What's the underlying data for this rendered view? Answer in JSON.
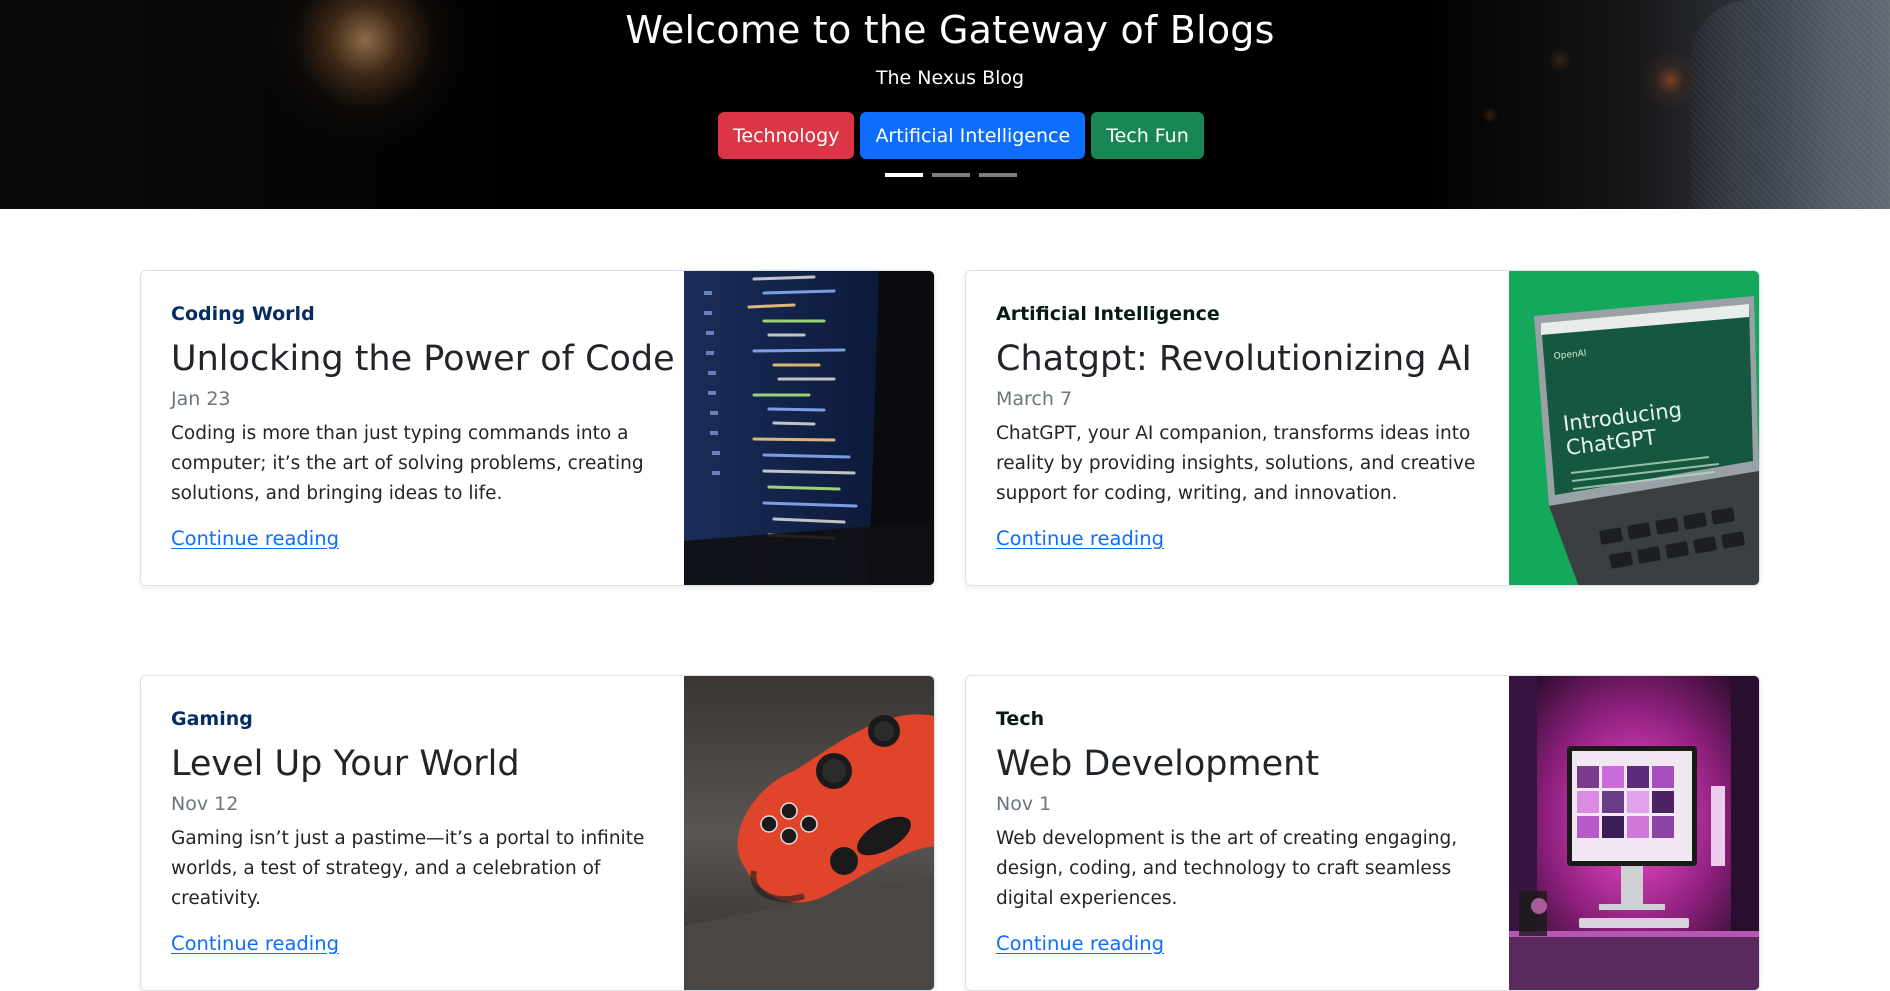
{
  "hero": {
    "title": "Welcome to the Gateway of Blogs",
    "subtitle": "The Nexus Blog",
    "buttons": [
      {
        "label": "Technology",
        "color": "#dc3545"
      },
      {
        "label": "Artificial Intelligence",
        "color": "#0d6efd"
      },
      {
        "label": "Tech Fun",
        "color": "#198754"
      }
    ],
    "carousel_indicators": {
      "count": 3,
      "active_index": 0
    }
  },
  "posts": [
    {
      "category": "Coding World",
      "category_color": "#052c65",
      "title": "Unlocking the Power of Code",
      "date": "Jan 23",
      "excerpt": "Coding is more than just typing commands into a computer; it’s the art of solving problems, creating solutions, and bringing ideas to life.",
      "link_label": "Continue reading",
      "image": "laptop-code-photo",
      "image_text": []
    },
    {
      "category": "Artificial Intelligence",
      "category_color": "#051b11",
      "title": "Chatgpt: Revolutionizing AI",
      "date": "March 7",
      "excerpt": "ChatGPT, your AI companion, transforms ideas into reality by providing insights, solutions, and creative support for coding, writing, and innovation.",
      "link_label": "Continue reading",
      "image": "laptop-chatgpt-photo",
      "image_text": [
        "Introducing",
        "ChatGPT",
        "OpenAI"
      ]
    },
    {
      "category": "Gaming",
      "category_color": "#052c65",
      "title": "Level Up Your World",
      "date": "Nov 12",
      "excerpt": "Gaming isn’t just a pastime—it’s a portal to infinite worlds, a test of strategy, and a celebration of creativity.",
      "link_label": "Continue reading",
      "image": "game-controller-photo",
      "image_text": []
    },
    {
      "category": "Tech",
      "category_color": "#051b11",
      "title": "Web Development",
      "date": "Nov 1",
      "excerpt": "Web development is the art of creating engaging, design, coding, and technology to craft seamless digital experiences.",
      "link_label": "Continue reading",
      "image": "desk-setup-photo",
      "image_text": []
    }
  ]
}
